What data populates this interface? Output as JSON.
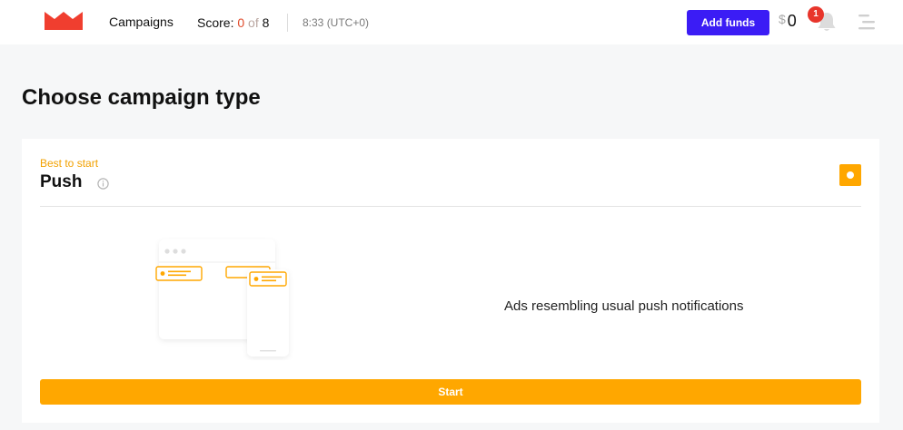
{
  "header": {
    "nav_campaigns": "Campaigns",
    "score_label": "Score:",
    "score_current": "0",
    "score_of": "of",
    "score_total": "8",
    "clock": "8:33 (UTC+0)",
    "add_funds_label": "Add funds",
    "balance_currency": "$",
    "balance_value": "0",
    "notification_count": "1",
    "icons": [
      "crown-logo-icon",
      "bell-icon",
      "menu-icon"
    ]
  },
  "main": {
    "page_title": "Choose campaign type"
  },
  "campaign_card": {
    "tag": "Best to start",
    "title": "Push",
    "selected": true,
    "description": "Ads resembling usual push notifications",
    "start_label": "Start",
    "icons": [
      "info-icon",
      "push-notification-illustration"
    ]
  },
  "colors": {
    "primary_button": "#3b1cf5",
    "accent_orange": "#ffa700",
    "logo_red": "#f03e2f",
    "badge_red": "#e8352b"
  }
}
